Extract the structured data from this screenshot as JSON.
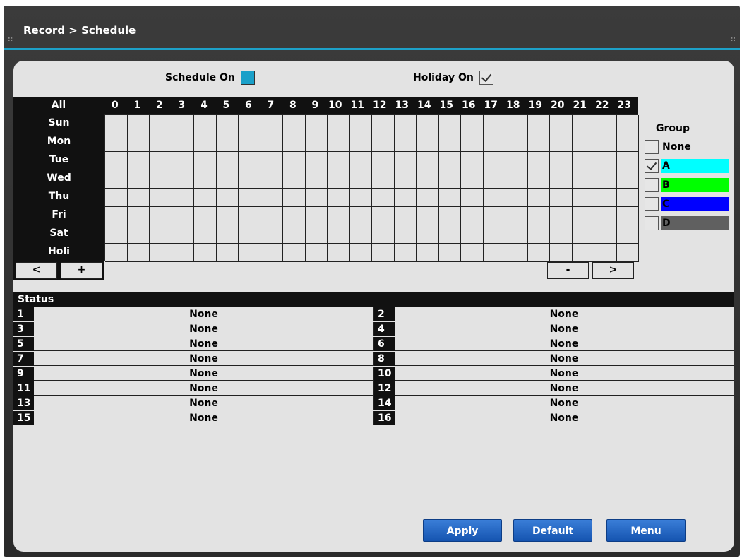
{
  "title": "Record > Schedule",
  "schedule_on": {
    "label": "Schedule On",
    "checked": true
  },
  "holiday_on": {
    "label": "Holiday On",
    "checked": true
  },
  "grid": {
    "all_label": "All",
    "hours": [
      "0",
      "1",
      "2",
      "3",
      "4",
      "5",
      "6",
      "7",
      "8",
      "9",
      "10",
      "11",
      "12",
      "13",
      "14",
      "15",
      "16",
      "17",
      "18",
      "19",
      "20",
      "21",
      "22",
      "23"
    ],
    "days": [
      "Sun",
      "Mon",
      "Tue",
      "Wed",
      "Thu",
      "Fri",
      "Sat",
      "Holi"
    ],
    "nav": {
      "prev": "<",
      "add": "+",
      "remove": "-",
      "next": ">"
    }
  },
  "group": {
    "title": "Group",
    "items": [
      {
        "label": "None",
        "checked": false,
        "color": ""
      },
      {
        "label": "A",
        "checked": true,
        "color": "#00ffff"
      },
      {
        "label": "B",
        "checked": false,
        "color": "#00ff00"
      },
      {
        "label": "C",
        "checked": false,
        "color": "#0000ff"
      },
      {
        "label": "D",
        "checked": false,
        "color": "#606060"
      }
    ]
  },
  "status": {
    "title": "Status",
    "channels": [
      {
        "num": "1",
        "value": "None"
      },
      {
        "num": "2",
        "value": "None"
      },
      {
        "num": "3",
        "value": "None"
      },
      {
        "num": "4",
        "value": "None"
      },
      {
        "num": "5",
        "value": "None"
      },
      {
        "num": "6",
        "value": "None"
      },
      {
        "num": "7",
        "value": "None"
      },
      {
        "num": "8",
        "value": "None"
      },
      {
        "num": "9",
        "value": "None"
      },
      {
        "num": "10",
        "value": "None"
      },
      {
        "num": "11",
        "value": "None"
      },
      {
        "num": "12",
        "value": "None"
      },
      {
        "num": "13",
        "value": "None"
      },
      {
        "num": "14",
        "value": "None"
      },
      {
        "num": "15",
        "value": "None"
      },
      {
        "num": "16",
        "value": "None"
      }
    ]
  },
  "buttons": {
    "apply": "Apply",
    "default": "Default",
    "menu": "Menu"
  },
  "colors": {
    "accent": "#1da1c8",
    "button": "#1f63c4",
    "schedule_on": "#1aa0c9"
  }
}
